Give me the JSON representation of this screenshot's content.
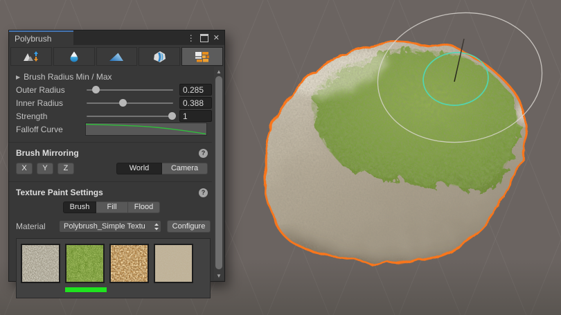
{
  "window": {
    "title": "Polybrush"
  },
  "toolbar": {
    "modes": [
      {
        "name": "sculpt-raise-lower"
      },
      {
        "name": "smooth"
      },
      {
        "name": "paint-vertex-colors"
      },
      {
        "name": "scatter-prefabs"
      },
      {
        "name": "paint-textures",
        "selected": true
      }
    ]
  },
  "brush_settings": {
    "foldout": "Brush Radius Min / Max",
    "outer_radius": {
      "label": "Outer Radius",
      "value": "0.285"
    },
    "inner_radius": {
      "label": "Inner Radius",
      "value": "0.388"
    },
    "strength": {
      "label": "Strength",
      "value": "1"
    },
    "falloff": {
      "label": "Falloff Curve"
    }
  },
  "mirroring": {
    "header": "Brush Mirroring",
    "axis_x": "X",
    "axis_y": "Y",
    "axis_z": "Z",
    "world": "World",
    "camera": "Camera"
  },
  "texture_paint": {
    "header": "Texture Paint Settings",
    "brush": "Brush",
    "fill": "Fill",
    "flood": "Flood",
    "material_label": "Material",
    "material_value": "Polybrush_Simple Textu",
    "configure": "Configure"
  },
  "palette": {
    "textures": [
      "gravel-gray",
      "grass-green",
      "leafy-brown",
      "sand-tan"
    ],
    "selected_index": 1
  },
  "colors": {
    "tab_accent_blue": "#4676B4",
    "selection_outline_orange": "#F8761C",
    "brush_inner_ring_teal": "#4FD8B6",
    "brush_outer_ring": "#DFDBD6",
    "palette_selected_green": "#1FE31F",
    "scene_background": "#6B6461"
  }
}
